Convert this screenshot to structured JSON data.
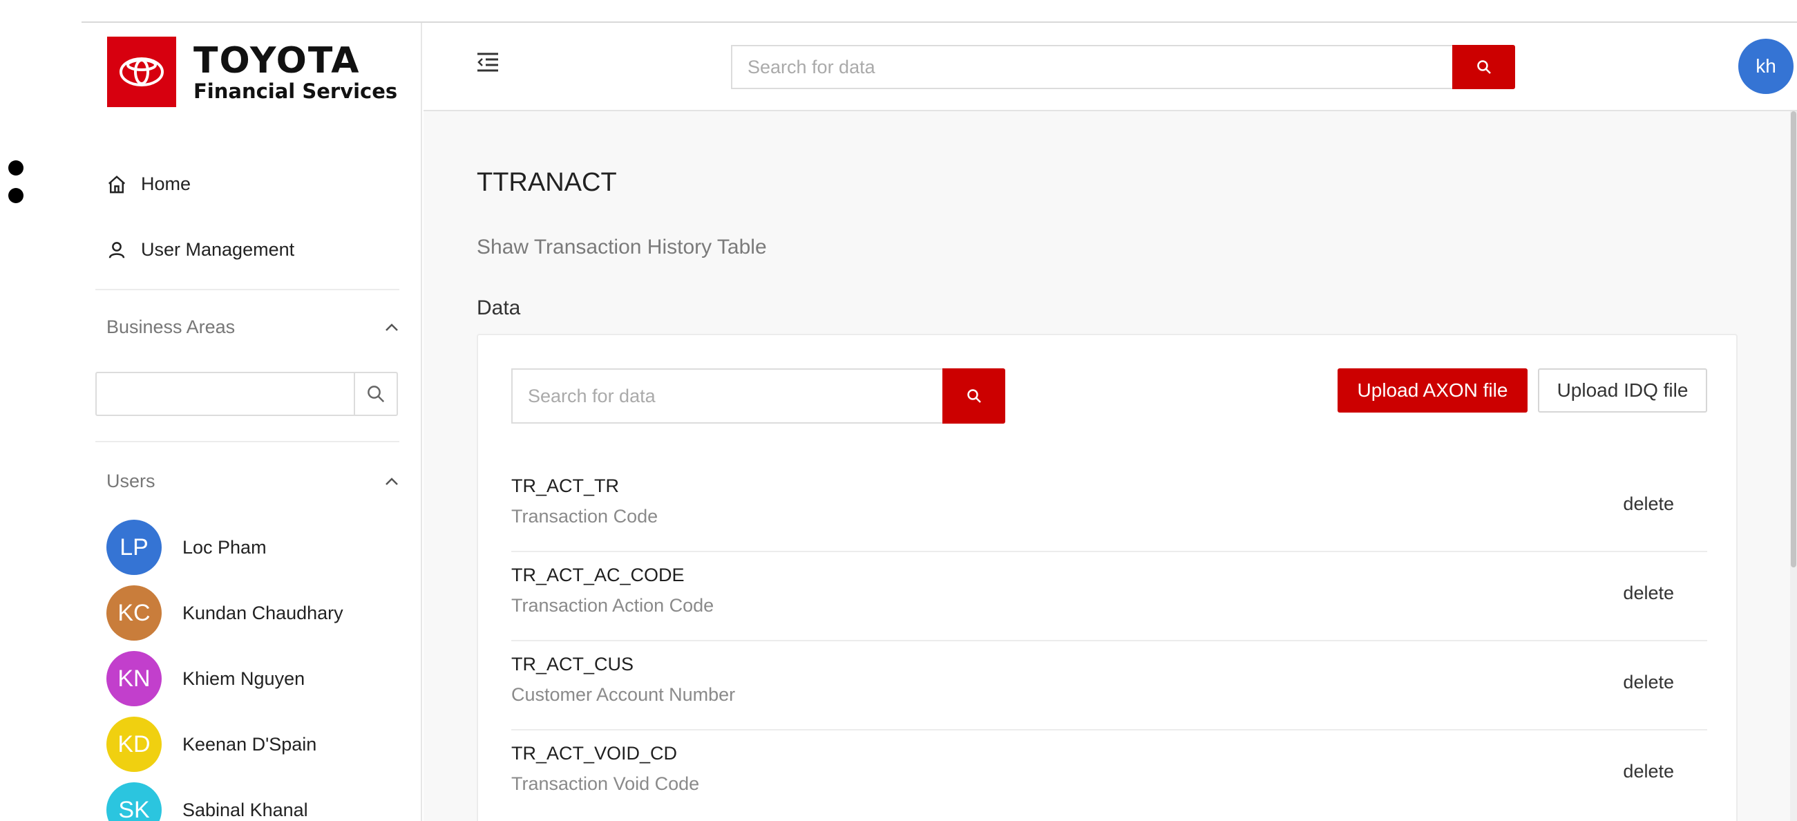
{
  "brand": {
    "name": "TOYOTA",
    "subtitle": "Financial Services",
    "color": "#d7000f"
  },
  "header": {
    "search": {
      "placeholder": "Search for data",
      "value": ""
    },
    "user_initials": "kh"
  },
  "sidebar": {
    "nav": [
      {
        "label": "Home",
        "icon": "home-icon"
      },
      {
        "label": "User Management",
        "icon": "user-icon"
      }
    ],
    "business_areas": {
      "title": "Business Areas",
      "search_value": ""
    },
    "users": {
      "title": "Users",
      "items": [
        {
          "initials": "LP",
          "name": "Loc Pham",
          "color": "#3574d4"
        },
        {
          "initials": "KC",
          "name": "Kundan Chaudhary",
          "color": "#c97d3b"
        },
        {
          "initials": "KN",
          "name": "Khiem Nguyen",
          "color": "#c23fcc"
        },
        {
          "initials": "KD",
          "name": "Keenan D'Spain",
          "color": "#f0d010"
        },
        {
          "initials": "SK",
          "name": "Sabinal Khanal",
          "color": "#2bc5df"
        }
      ]
    }
  },
  "main": {
    "title": "TTRANACT",
    "subtitle": "Shaw Transaction History Table",
    "section_label": "Data",
    "card": {
      "search_placeholder": "Search for data",
      "upload_axon": "Upload AXON file",
      "upload_idq": "Upload IDQ file",
      "rows": [
        {
          "code": "TR_ACT_TR",
          "description": "Transaction Code",
          "action": "delete"
        },
        {
          "code": "TR_ACT_AC_CODE",
          "description": "Transaction Action Code",
          "action": "delete"
        },
        {
          "code": "TR_ACT_CUS",
          "description": "Customer Account Number",
          "action": "delete"
        },
        {
          "code": "TR_ACT_VOID_CD",
          "description": "Transaction Void Code",
          "action": "delete"
        }
      ]
    }
  },
  "colors": {
    "accent": "#cc0000",
    "user_badge": "#3574d4"
  }
}
